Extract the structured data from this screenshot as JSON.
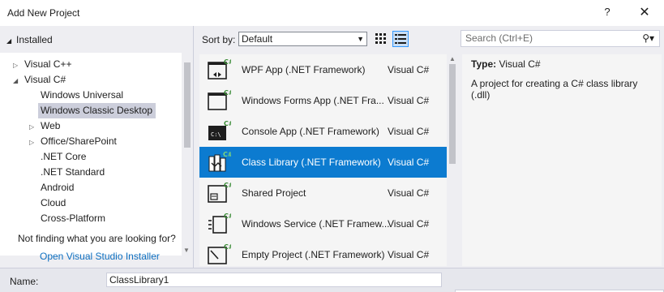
{
  "window": {
    "title": "Add New Project",
    "help": "?",
    "close": "✕"
  },
  "left": {
    "installed": "Installed",
    "tree": [
      {
        "label": "Visual C++",
        "expander": "▷"
      },
      {
        "label": "Visual C#",
        "expander": "◢"
      },
      {
        "label": "Windows Universal",
        "expander": ""
      },
      {
        "label": "Windows Classic Desktop",
        "expander": ""
      },
      {
        "label": "Web",
        "expander": "▷"
      },
      {
        "label": "Office/SharePoint",
        "expander": "▷"
      },
      {
        "label": ".NET Core",
        "expander": ""
      },
      {
        "label": ".NET Standard",
        "expander": ""
      },
      {
        "label": "Android",
        "expander": ""
      },
      {
        "label": "Cloud",
        "expander": ""
      },
      {
        "label": "Cross-Platform",
        "expander": ""
      }
    ],
    "not_finding": "Not finding what you are looking for?",
    "installer_link": "Open Visual Studio Installer"
  },
  "sort": {
    "label": "Sort by:",
    "value": "Default"
  },
  "templates": [
    {
      "name": "WPF App (.NET Framework)",
      "lang": "Visual C#",
      "icon": "wpf-app-icon"
    },
    {
      "name": "Windows Forms App (.NET Fra...",
      "lang": "Visual C#",
      "icon": "windows-forms-icon"
    },
    {
      "name": "Console App (.NET Framework)",
      "lang": "Visual C#",
      "icon": "console-app-icon"
    },
    {
      "name": "Class Library (.NET Framework)",
      "lang": "Visual C#",
      "icon": "class-library-icon"
    },
    {
      "name": "Shared Project",
      "lang": "Visual C#",
      "icon": "shared-project-icon"
    },
    {
      "name": "Windows Service (.NET Framew...",
      "lang": "Visual C#",
      "icon": "windows-service-icon"
    },
    {
      "name": "Empty Project (.NET Framework)",
      "lang": "Visual C#",
      "icon": "empty-project-icon"
    }
  ],
  "search": {
    "placeholder": "Search (Ctrl+E)"
  },
  "details": {
    "type_label": "Type:",
    "type_value": "Visual C#",
    "description": "A project for creating a C# class library (.dll)"
  },
  "bottom": {
    "name_label": "Name:",
    "name_value": "ClassLibrary1"
  },
  "colors": {
    "selection": "#0c7bd0",
    "link": "#0e70c0",
    "tree_selected": "#cccedb"
  }
}
